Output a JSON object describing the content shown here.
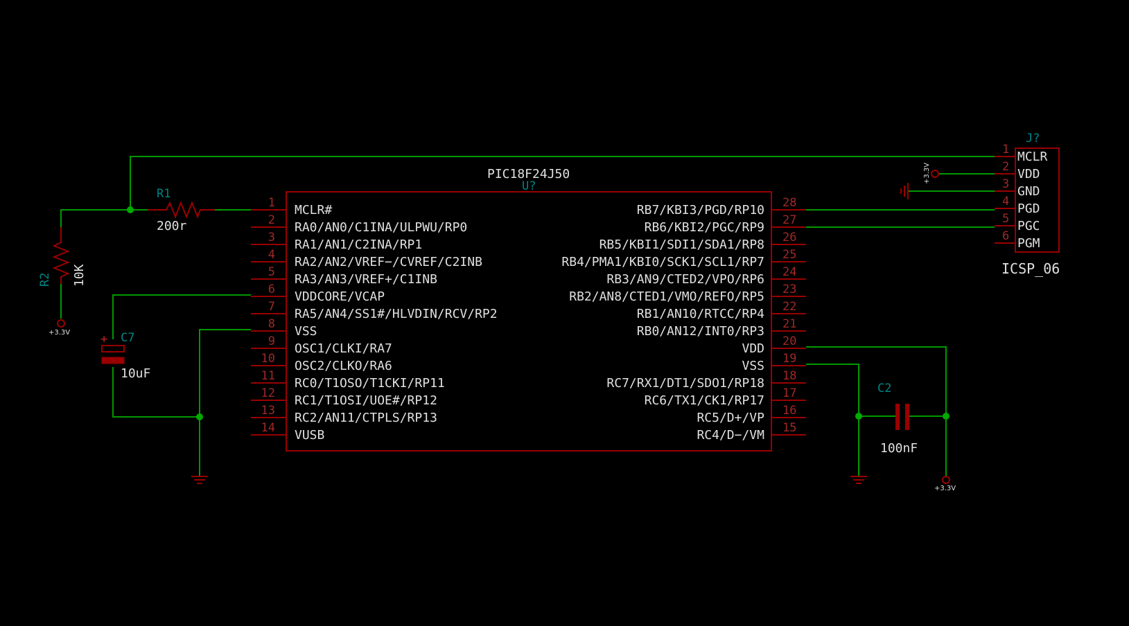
{
  "colors": {
    "background": "#000000",
    "wire": "#009900",
    "component": "#990000",
    "pin_number": "#a02828",
    "reference": "#008484",
    "text": "#e0e0e0",
    "junction": "#00aa00"
  },
  "ic": {
    "value": "PIC18F24J50",
    "ref": "U?",
    "left_pins": [
      {
        "num": "1",
        "name": "MCLR#"
      },
      {
        "num": "2",
        "name": "RA0/AN0/C1INA/ULPWU/RP0"
      },
      {
        "num": "3",
        "name": "RA1/AN1/C2INA/RP1"
      },
      {
        "num": "4",
        "name": "RA2/AN2/VREF−/CVREF/C2INB"
      },
      {
        "num": "5",
        "name": "RA3/AN3/VREF+/C1INB"
      },
      {
        "num": "6",
        "name": "VDDCORE/VCAP"
      },
      {
        "num": "7",
        "name": "RA5/AN4/SS1#/HLVDIN/RCV/RP2"
      },
      {
        "num": "8",
        "name": "VSS"
      },
      {
        "num": "9",
        "name": "OSC1/CLKI/RA7"
      },
      {
        "num": "10",
        "name": "OSC2/CLKO/RA6"
      },
      {
        "num": "11",
        "name": "RC0/T1OSO/T1CKI/RP11"
      },
      {
        "num": "12",
        "name": "RC1/T1OSI/UOE#/RP12"
      },
      {
        "num": "13",
        "name": "RC2/AN11/CTPLS/RP13"
      },
      {
        "num": "14",
        "name": "VUSB"
      }
    ],
    "right_pins": [
      {
        "num": "28",
        "name": "RB7/KBI3/PGD/RP10"
      },
      {
        "num": "27",
        "name": "RB6/KBI2/PGC/RP9"
      },
      {
        "num": "26",
        "name": "RB5/KBI1/SDI1/SDA1/RP8"
      },
      {
        "num": "25",
        "name": "RB4/PMA1/KBI0/SCK1/SCL1/RP7"
      },
      {
        "num": "24",
        "name": "RB3/AN9/CTED2/VPO/RP6"
      },
      {
        "num": "23",
        "name": "RB2/AN8/CTED1/VMO/REFO/RP5"
      },
      {
        "num": "22",
        "name": "RB1/AN10/RTCC/RP4"
      },
      {
        "num": "21",
        "name": "RB0/AN12/INT0/RP3"
      },
      {
        "num": "20",
        "name": "VDD"
      },
      {
        "num": "19",
        "name": "VSS"
      },
      {
        "num": "18",
        "name": "RC7/RX1/DT1/SDO1/RP18"
      },
      {
        "num": "17",
        "name": "RC6/TX1/CK1/RP17"
      },
      {
        "num": "16",
        "name": "RC5/D+/VP"
      },
      {
        "num": "15",
        "name": "RC4/D−/VM"
      }
    ]
  },
  "connector": {
    "ref": "J?",
    "value": "ICSP_06",
    "pins": [
      {
        "num": "1",
        "name": "MCLR"
      },
      {
        "num": "2",
        "name": "VDD"
      },
      {
        "num": "3",
        "name": "GND"
      },
      {
        "num": "4",
        "name": "PGD"
      },
      {
        "num": "5",
        "name": "PGC"
      },
      {
        "num": "6",
        "name": "PGM"
      }
    ]
  },
  "r1": {
    "ref": "R1",
    "value": "200r"
  },
  "r2": {
    "ref": "R2",
    "value": "10K"
  },
  "c7": {
    "ref": "C7",
    "value": "10uF",
    "polarity": "+"
  },
  "c2": {
    "ref": "C2",
    "value": "100nF"
  },
  "power": {
    "vcc_label": "+3.3V"
  }
}
